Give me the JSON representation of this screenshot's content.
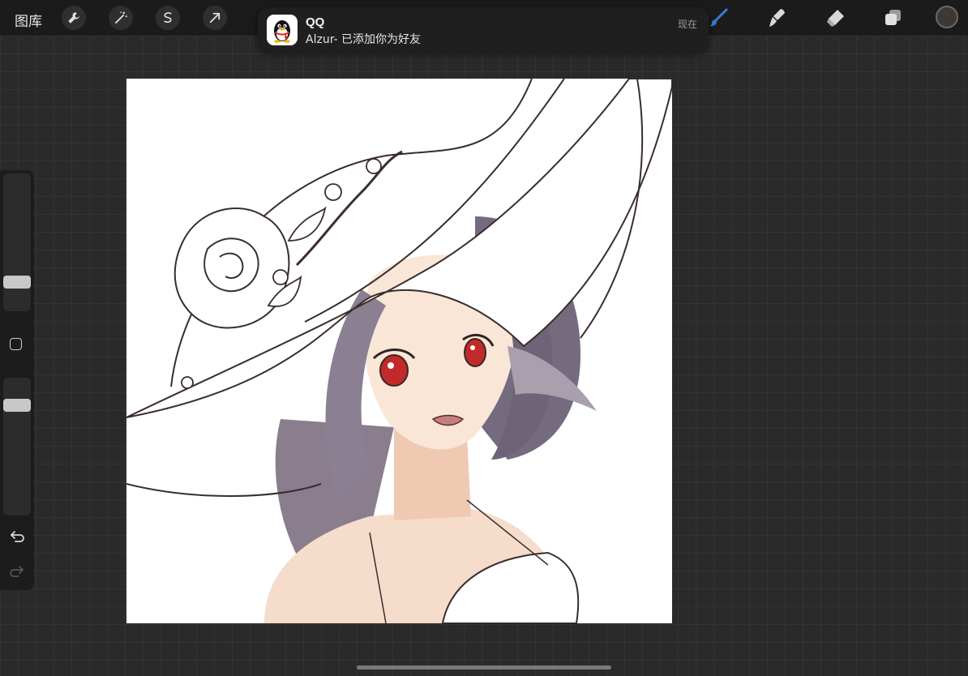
{
  "topbar": {
    "gallery_label": "图库",
    "left_tools": [
      {
        "icon": "wrench-icon"
      },
      {
        "icon": "magic-wand-icon"
      },
      {
        "icon": "selection-icon"
      },
      {
        "icon": "transform-arrow-icon"
      }
    ],
    "right_tools": [
      {
        "icon": "brush-icon",
        "active_color": "#3a7bd5"
      },
      {
        "icon": "smudge-icon"
      },
      {
        "icon": "eraser-icon"
      },
      {
        "icon": "layers-icon"
      }
    ],
    "current_color": "#3f3733"
  },
  "notification": {
    "app_icon": "qq-penguin-icon",
    "title": "QQ",
    "body": "Alzur- 已添加你为好友",
    "time": "现在"
  },
  "sidebar": {
    "brush_size_level": 0.15,
    "opacity_level": 0.8,
    "modify_icon": "square-modify-icon",
    "undo_icon": "undo-icon",
    "redo_icon": "redo-icon"
  },
  "canvas": {
    "background": "#ffffff",
    "artwork": "anime-girl-illustration"
  }
}
